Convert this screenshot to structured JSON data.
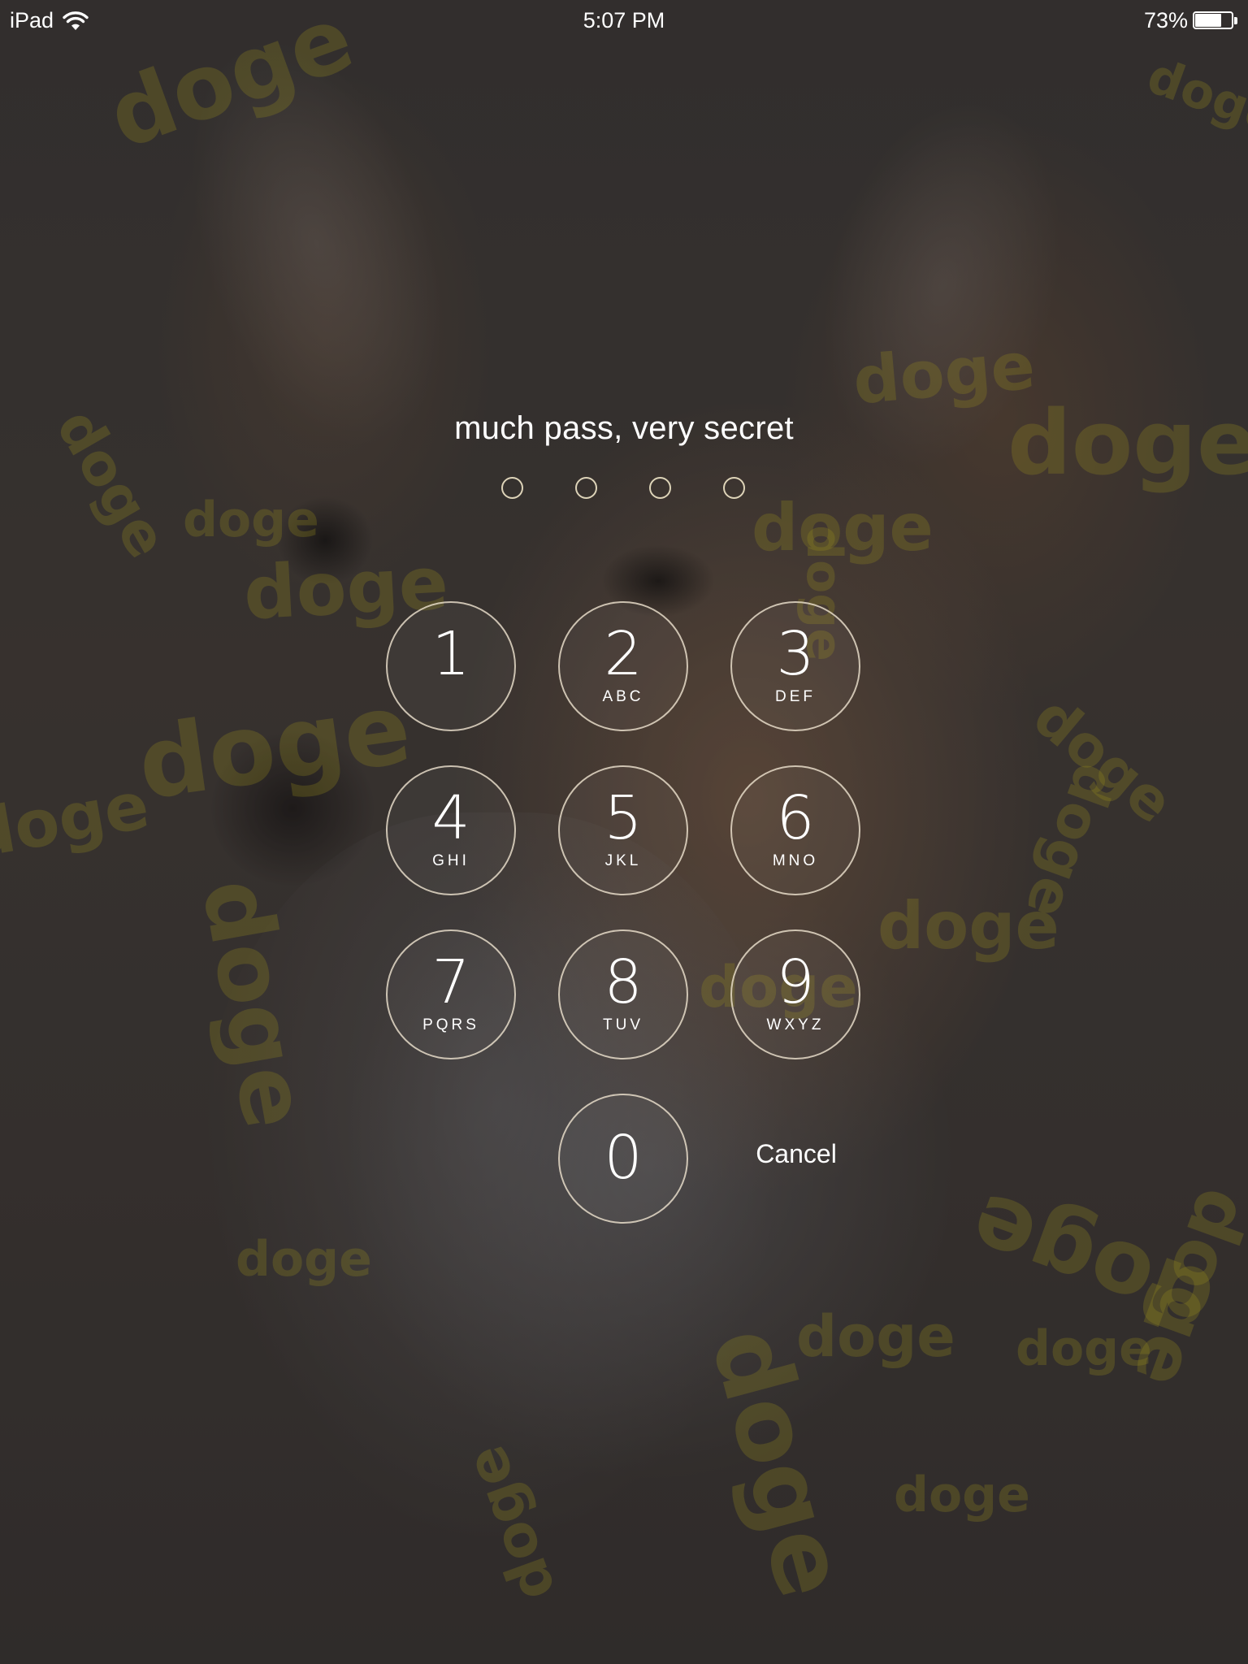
{
  "status_bar": {
    "device": "iPad",
    "time": "5:07 PM",
    "battery_percent": "73%",
    "battery_level": 0.73,
    "wifi_icon": "wifi-icon"
  },
  "lock_screen": {
    "prompt": "much pass, very secret",
    "passcode_length": 4,
    "entered_digits": 0,
    "keypad": [
      {
        "digit": "1",
        "letters": ""
      },
      {
        "digit": "2",
        "letters": "ABC"
      },
      {
        "digit": "3",
        "letters": "DEF"
      },
      {
        "digit": "4",
        "letters": "GHI"
      },
      {
        "digit": "5",
        "letters": "JKL"
      },
      {
        "digit": "6",
        "letters": "MNO"
      },
      {
        "digit": "7",
        "letters": "PQRS"
      },
      {
        "digit": "8",
        "letters": "TUV"
      },
      {
        "digit": "9",
        "letters": "WXYZ"
      },
      {
        "digit": "0",
        "letters": ""
      }
    ],
    "cancel_label": "Cancel"
  },
  "wallpaper": {
    "watermark_text": "doge",
    "watermark_color": "#968c1e"
  }
}
